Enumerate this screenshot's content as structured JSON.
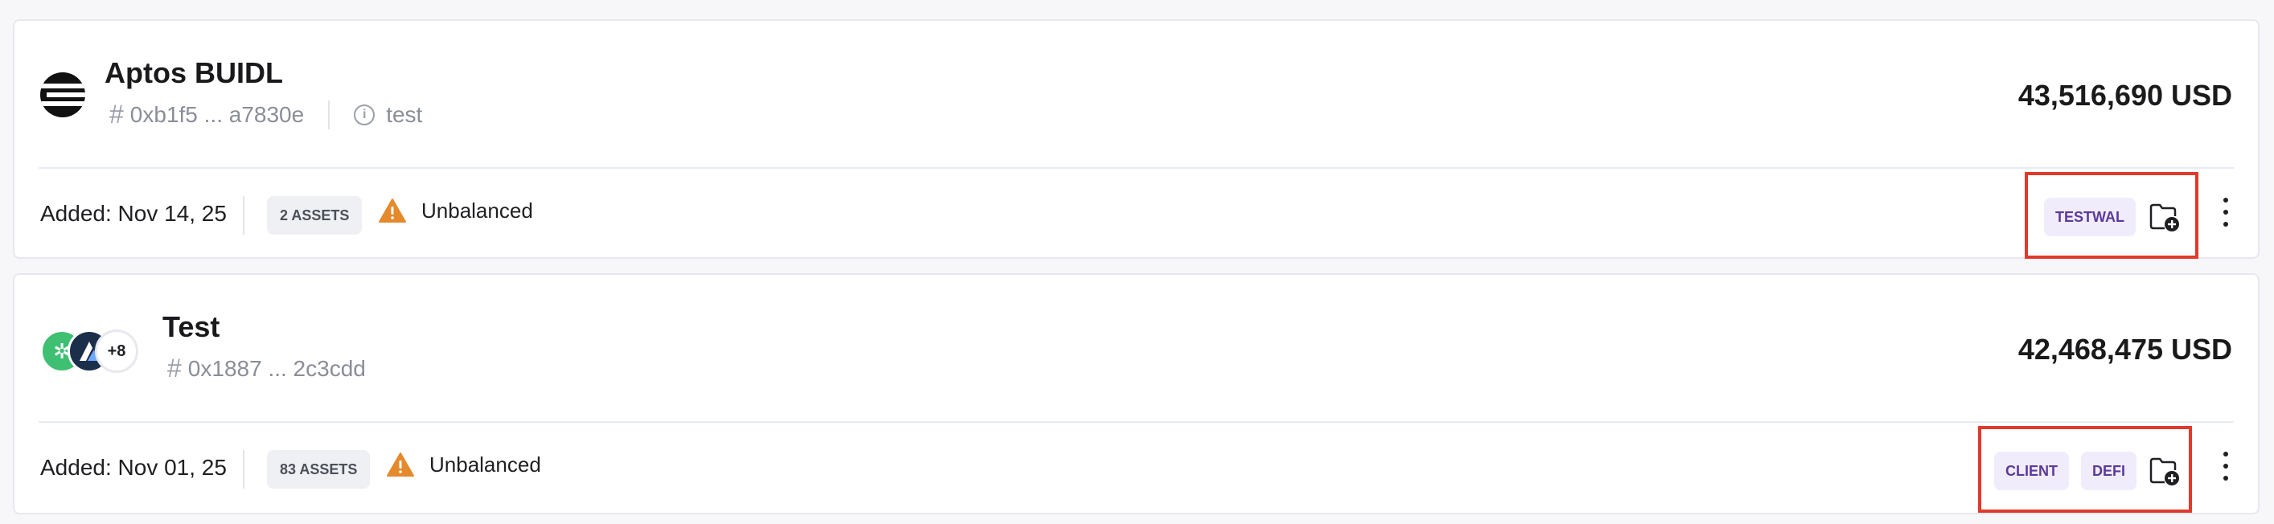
{
  "wallets": [
    {
      "name": "Aptos BUIDL",
      "address": "0xb1f5 ... a7830e",
      "note": "test",
      "balance": "43,516,690 USD",
      "added": "Added: Nov 14, 25",
      "assets": "2 ASSETS",
      "status": "Unbalanced",
      "tags": [
        "TESTWAL"
      ]
    },
    {
      "name": "Test",
      "address": "0x1887 ... 2c3cdd",
      "logo_more": "+8",
      "balance": "42,468,475 USD",
      "added": "Added: Nov 01, 25",
      "assets": "83 ASSETS",
      "status": "Unbalanced",
      "tags": [
        "CLIENT",
        "DEFI"
      ]
    }
  ],
  "icons": {
    "hash": "hash-icon",
    "info": "info-icon",
    "warning": "warning-icon",
    "folder_add": "folder-add-icon",
    "more": "more-vertical-icon"
  },
  "colors": {
    "warning": "#e5892d",
    "tag_bg": "#f1ecfb",
    "tag_text": "#5c3a9a",
    "highlight_border": "#e03a2c"
  }
}
